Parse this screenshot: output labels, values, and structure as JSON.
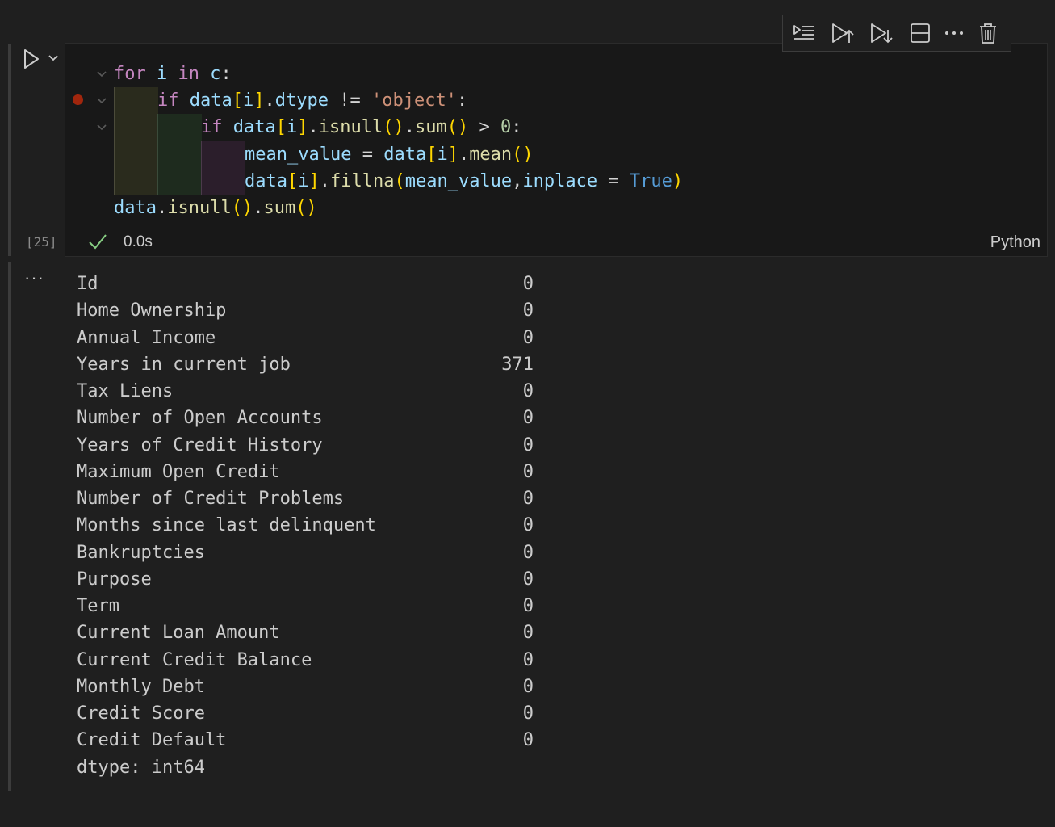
{
  "cell": {
    "execution_count": "[25]",
    "exec_time": "0.0s",
    "language": "Python",
    "toolbar": {
      "buttons": [
        {
          "name": "run-by-line-button",
          "icon": "run-by-line-icon"
        },
        {
          "name": "execute-above-button",
          "icon": "execute-above-icon"
        },
        {
          "name": "execute-below-button",
          "icon": "execute-below-icon"
        },
        {
          "name": "split-cell-button",
          "icon": "split-cell-icon"
        },
        {
          "name": "more-actions-button",
          "icon": "more-icon"
        },
        {
          "name": "delete-cell-button",
          "icon": "trash-icon"
        }
      ]
    }
  },
  "code": [
    {
      "tokens": [
        [
          "kw",
          "for"
        ],
        [
          "plain",
          " "
        ],
        [
          "var",
          "i"
        ],
        [
          "plain",
          " "
        ],
        [
          "kw",
          "in"
        ],
        [
          "plain",
          " "
        ],
        [
          "var",
          "c"
        ],
        [
          "plain",
          ":"
        ]
      ]
    },
    {
      "tokens": [
        [
          "kw",
          "if"
        ],
        [
          "plain",
          " "
        ],
        [
          "var",
          "data"
        ],
        [
          "br1",
          "["
        ],
        [
          "var",
          "i"
        ],
        [
          "br1",
          "]"
        ],
        [
          "plain",
          "."
        ],
        [
          "var",
          "dtype"
        ],
        [
          "plain",
          " "
        ],
        [
          "op",
          "!="
        ],
        [
          "plain",
          " "
        ],
        [
          "str",
          "'object'"
        ],
        [
          "plain",
          ":"
        ]
      ]
    },
    {
      "tokens": [
        [
          "kw",
          "if"
        ],
        [
          "plain",
          " "
        ],
        [
          "var",
          "data"
        ],
        [
          "br1",
          "["
        ],
        [
          "var",
          "i"
        ],
        [
          "br1",
          "]"
        ],
        [
          "plain",
          "."
        ],
        [
          "fn",
          "isnull"
        ],
        [
          "br1",
          "()"
        ],
        [
          "plain",
          "."
        ],
        [
          "fn",
          "sum"
        ],
        [
          "br1",
          "()"
        ],
        [
          "plain",
          " "
        ],
        [
          "op",
          ">"
        ],
        [
          "plain",
          " "
        ],
        [
          "num",
          "0"
        ],
        [
          "plain",
          ":"
        ]
      ]
    },
    {
      "tokens": [
        [
          "var",
          "mean_value"
        ],
        [
          "plain",
          " "
        ],
        [
          "op",
          "="
        ],
        [
          "plain",
          " "
        ],
        [
          "var",
          "data"
        ],
        [
          "br1",
          "["
        ],
        [
          "var",
          "i"
        ],
        [
          "br1",
          "]"
        ],
        [
          "plain",
          "."
        ],
        [
          "fn",
          "mean"
        ],
        [
          "br1",
          "()"
        ]
      ]
    },
    {
      "tokens": [
        [
          "var",
          "data"
        ],
        [
          "br1",
          "["
        ],
        [
          "var",
          "i"
        ],
        [
          "br1",
          "]"
        ],
        [
          "plain",
          "."
        ],
        [
          "fn",
          "fillna"
        ],
        [
          "br1",
          "("
        ],
        [
          "var",
          "mean_value"
        ],
        [
          "plain",
          ","
        ],
        [
          "var",
          "inplace"
        ],
        [
          "plain",
          " "
        ],
        [
          "op",
          "="
        ],
        [
          "plain",
          " "
        ],
        [
          "bool",
          "True"
        ],
        [
          "br1",
          ")"
        ]
      ]
    },
    {
      "tokens": [
        [
          "var",
          "data"
        ],
        [
          "plain",
          "."
        ],
        [
          "fn",
          "isnull"
        ],
        [
          "br1",
          "()"
        ],
        [
          "plain",
          "."
        ],
        [
          "fn",
          "sum"
        ],
        [
          "br1",
          "()"
        ]
      ]
    }
  ],
  "output": {
    "rows": [
      {
        "label": "Id",
        "value": "0"
      },
      {
        "label": "Home Ownership",
        "value": "0"
      },
      {
        "label": "Annual Income",
        "value": "0"
      },
      {
        "label": "Years in current job",
        "value": "371"
      },
      {
        "label": "Tax Liens",
        "value": "0"
      },
      {
        "label": "Number of Open Accounts",
        "value": "0"
      },
      {
        "label": "Years of Credit History",
        "value": "0"
      },
      {
        "label": "Maximum Open Credit",
        "value": "0"
      },
      {
        "label": "Number of Credit Problems",
        "value": "0"
      },
      {
        "label": "Months since last delinquent",
        "value": "0"
      },
      {
        "label": "Bankruptcies",
        "value": "0"
      },
      {
        "label": "Purpose",
        "value": "0"
      },
      {
        "label": "Term",
        "value": "0"
      },
      {
        "label": "Current Loan Amount",
        "value": "0"
      },
      {
        "label": "Current Credit Balance",
        "value": "0"
      },
      {
        "label": "Monthly Debt",
        "value": "0"
      },
      {
        "label": "Credit Score",
        "value": "0"
      },
      {
        "label": "Credit Default",
        "value": "0"
      }
    ],
    "dtype_line": "dtype: int64"
  }
}
